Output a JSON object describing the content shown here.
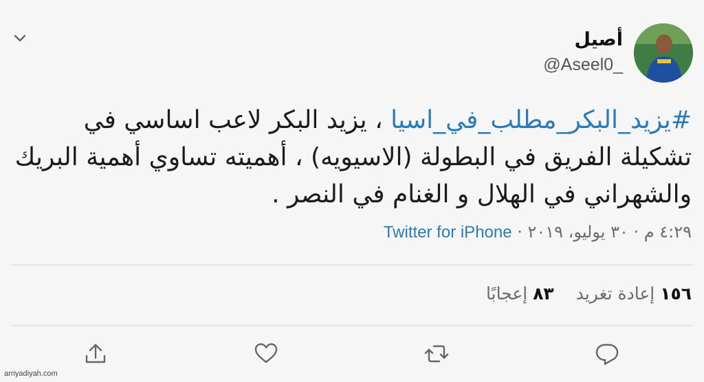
{
  "author": {
    "name": "أصيل",
    "handle": "@Aseel0_"
  },
  "tweet": {
    "hashtag": "#يزيد_البكر_مطلب_في_اسيا",
    "text_after_hashtag": " ، يزيد البكر لاعب اساسي في تشكيلة الفريق في البطولة (الاسيويه) ، أهميته تساوي أهمية البريك والشهراني في الهلال و الغنام في النصر ."
  },
  "meta": {
    "timestamp": "٤:٢٩ م · ٣٠ يوليو، ٢٠١٩ · ",
    "source": "Twitter for iPhone"
  },
  "stats": {
    "retweets_count": "١٥٦",
    "retweets_label": "إعادة تغريد",
    "likes_count": "٨٣",
    "likes_label": "إعجابًا"
  },
  "icons": {
    "menu": "chevron-down-icon",
    "reply": "reply-icon",
    "retweet": "retweet-icon",
    "like": "heart-icon",
    "share": "share-icon"
  },
  "watermark": "arriyadiyah.com"
}
